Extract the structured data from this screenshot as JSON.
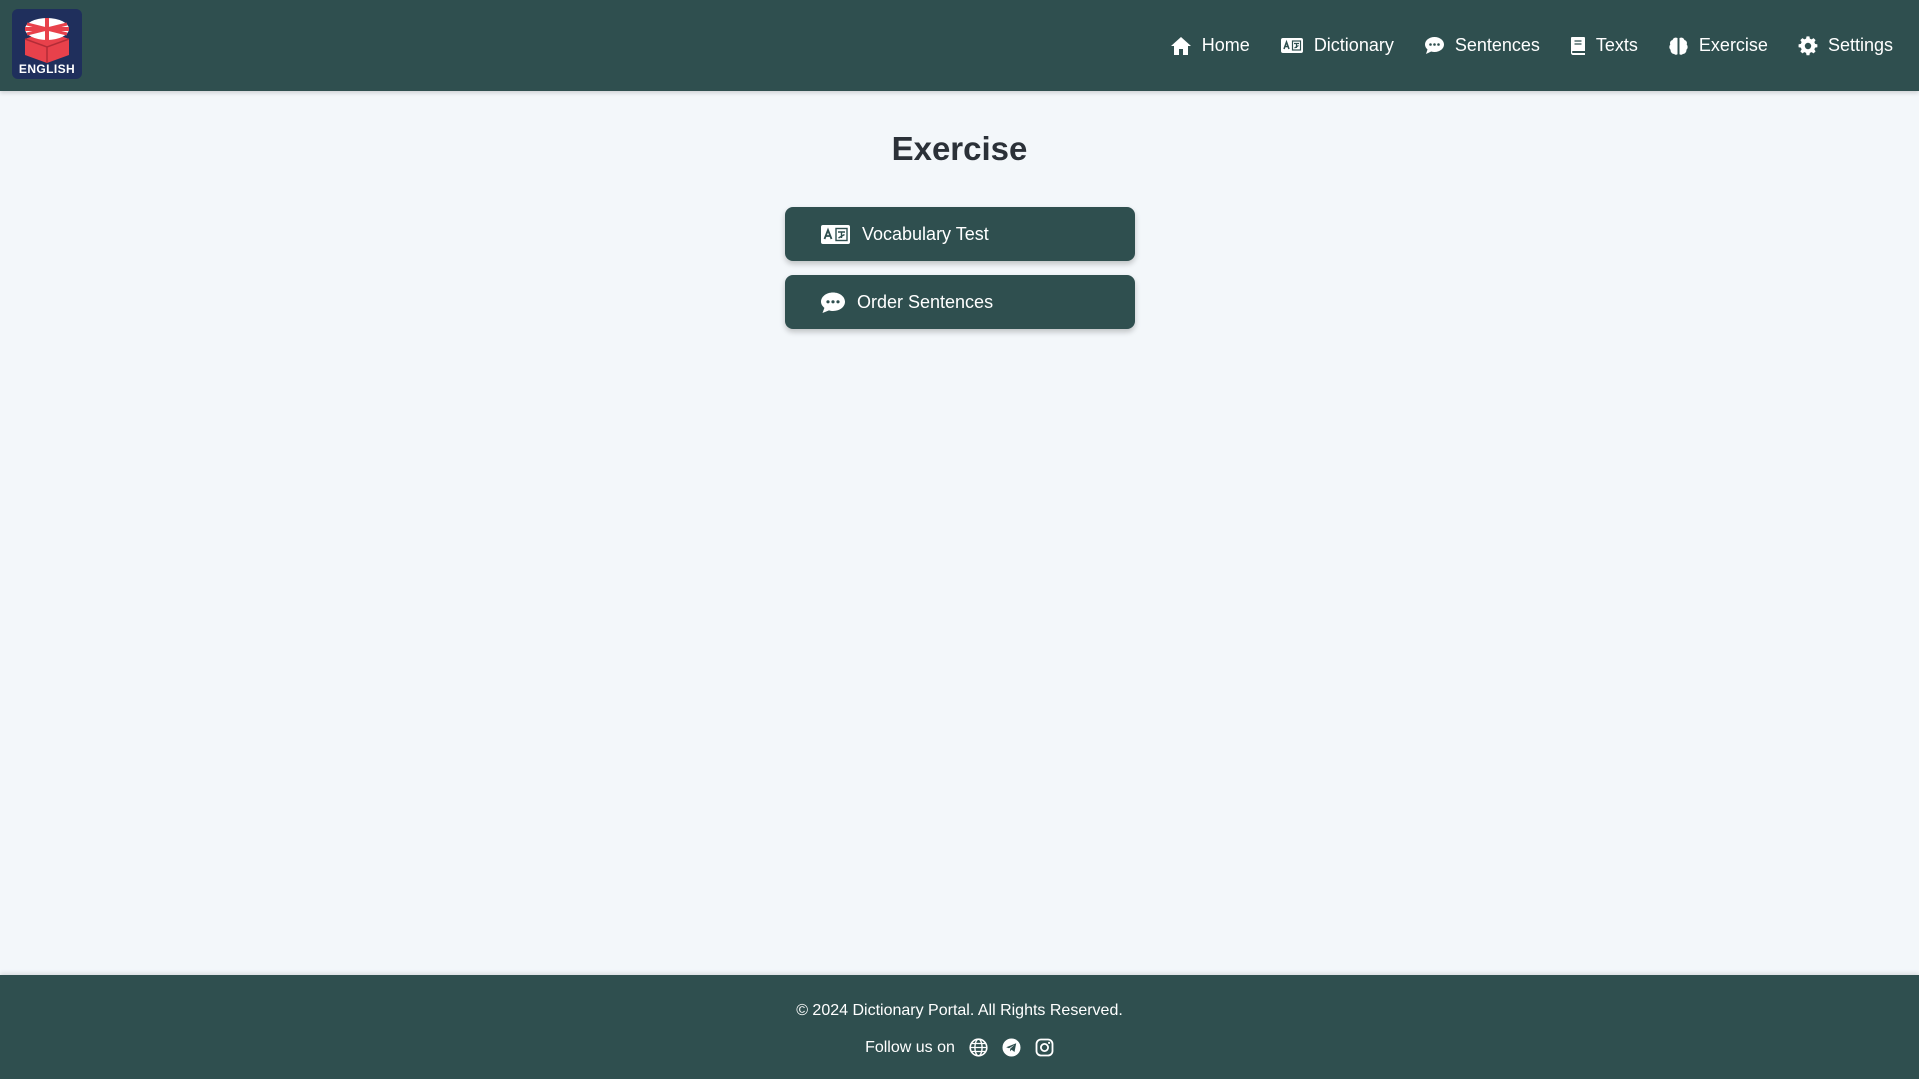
{
  "brand": {
    "logo_text": "ENGLISH",
    "logo_bg": "#1f2f5c",
    "logo_accent": "#e8414b"
  },
  "nav": {
    "items": [
      {
        "label": "Home",
        "icon": "home-icon"
      },
      {
        "label": "Dictionary",
        "icon": "language-card-icon"
      },
      {
        "label": "Sentences",
        "icon": "comment-dots-icon"
      },
      {
        "label": "Texts",
        "icon": "book-icon"
      },
      {
        "label": "Exercise",
        "icon": "brain-icon"
      },
      {
        "label": "Settings",
        "icon": "gear-icon"
      }
    ]
  },
  "main": {
    "title": "Exercise",
    "buttons": [
      {
        "label": "Vocabulary Test",
        "icon": "language-card-icon"
      },
      {
        "label": "Order Sentences",
        "icon": "comments-icon"
      }
    ]
  },
  "footer": {
    "copyright": "© 2024 Dictionary Portal. All Rights Reserved.",
    "follow_label": "Follow us on",
    "social": [
      "globe-icon",
      "telegram-icon",
      "instagram-icon"
    ]
  },
  "colors": {
    "header_bg": "#2f4f4f",
    "page_bg": "#f3f7fa",
    "button_bg": "#2f4f4f",
    "text_dark": "#2b3138"
  }
}
